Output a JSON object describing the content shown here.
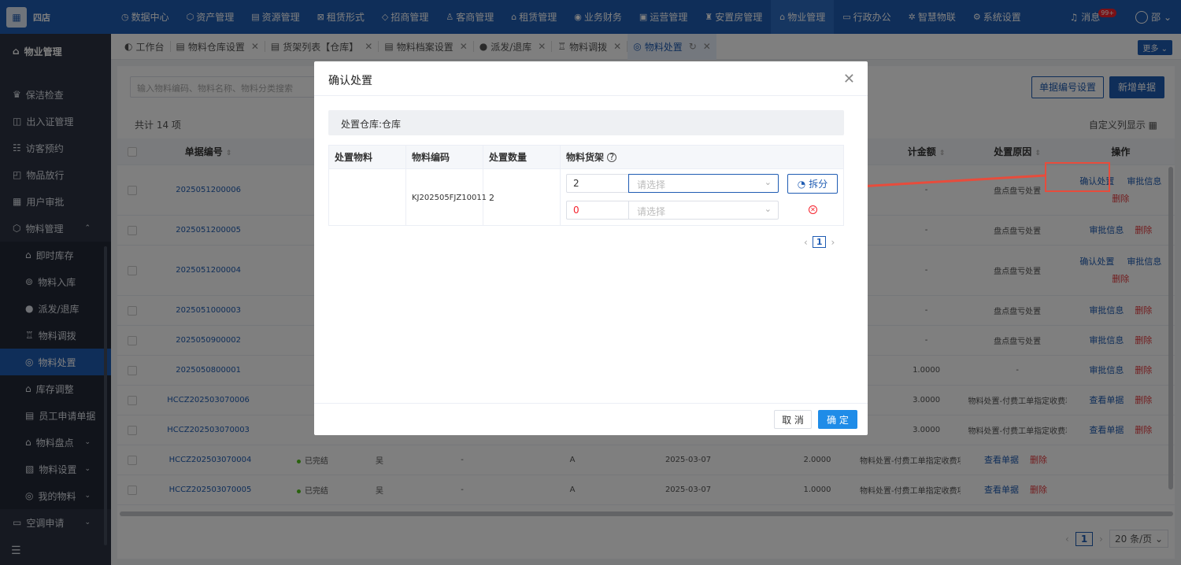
{
  "app": {
    "logo_text": "四店"
  },
  "topnav": {
    "items": [
      {
        "label": "数据中心",
        "icon": "◷"
      },
      {
        "label": "资产管理",
        "icon": "⬡"
      },
      {
        "label": "资源管理",
        "icon": "▤"
      },
      {
        "label": "租赁形式",
        "icon": "⊠"
      },
      {
        "label": "招商管理",
        "icon": "◇"
      },
      {
        "label": "客商管理",
        "icon": "♙"
      },
      {
        "label": "租赁管理",
        "icon": "⌂"
      },
      {
        "label": "业务财务",
        "icon": "◉"
      },
      {
        "label": "运营管理",
        "icon": "▣"
      },
      {
        "label": "安置房管理",
        "icon": "♜"
      },
      {
        "label": "物业管理",
        "icon": "⌂"
      },
      {
        "label": "行政办公",
        "icon": "▭"
      },
      {
        "label": "智慧物联",
        "icon": "✲"
      },
      {
        "label": "系统设置",
        "icon": "⚙"
      }
    ],
    "active_index": 10,
    "message_label": "消息",
    "badge": "99+",
    "user_name": "邵"
  },
  "sidebar": {
    "title": "物业管理",
    "items": [
      {
        "label": "保洁检查",
        "icon": "♛"
      },
      {
        "label": "出入证管理",
        "icon": "◫"
      },
      {
        "label": "访客预约",
        "icon": "☷"
      },
      {
        "label": "物品放行",
        "icon": "◰"
      },
      {
        "label": "用户审批",
        "icon": "▦"
      },
      {
        "label": "物料管理",
        "icon": "⬡",
        "arrow": "⌃"
      }
    ],
    "sub_items": [
      {
        "label": "即时库存",
        "icon": "⌂"
      },
      {
        "label": "物料入库",
        "icon": "⊚"
      },
      {
        "label": "派发/退库",
        "icon": "●"
      },
      {
        "label": "物料调拨",
        "icon": "♖"
      },
      {
        "label": "物料处置",
        "icon": "◎"
      },
      {
        "label": "库存调整",
        "icon": "⌂"
      },
      {
        "label": "员工申请单据",
        "icon": "▤"
      },
      {
        "label": "物料盘点",
        "icon": "⌂",
        "arrow": "⌄"
      },
      {
        "label": "物料设置",
        "icon": "▧",
        "arrow": "⌄"
      },
      {
        "label": "我的物料",
        "icon": "◎",
        "arrow": "⌄"
      }
    ],
    "after_items": [
      {
        "label": "空调申请",
        "icon": "▭",
        "arrow": "⌄"
      }
    ]
  },
  "tabs": [
    {
      "label": "工作台",
      "icon": "◐",
      "closable": false
    },
    {
      "label": "物料仓库设置",
      "icon": "▤",
      "closable": true
    },
    {
      "label": "货架列表【仓库】",
      "icon": "▤",
      "closable": true
    },
    {
      "label": "物料档案设置",
      "icon": "▤",
      "closable": true
    },
    {
      "label": "派发/退库",
      "icon": "●",
      "closable": true
    },
    {
      "label": "物料调拨",
      "icon": "♖",
      "closable": true
    },
    {
      "label": "物料处置",
      "icon": "◎",
      "closable": true,
      "active": true
    }
  ],
  "more_label": "更多",
  "toolbar": {
    "search_placeholder": "输入物料编码、物料名称、物料分类搜索",
    "btn_code_setting": "单据编号设置",
    "btn_new": "新增单据"
  },
  "list": {
    "total": "共计 14 项",
    "col_setting": "自定义列显示",
    "headers": {
      "no": "单据编号",
      "amount": "计金额",
      "reason": "处置原因",
      "ops": "操作"
    },
    "rows": [
      {
        "no": "2025051200006",
        "amount": "-",
        "reason": "盘点盘亏处置",
        "ops": [
          "确认处置",
          "审批信息"
        ],
        "del": "删除",
        "two_line": true
      },
      {
        "no": "2025051200005",
        "amount": "-",
        "reason": "盘点盘亏处置",
        "ops": [
          "审批信息"
        ],
        "del": "删除"
      },
      {
        "no": "2025051200004",
        "amount": "-",
        "reason": "盘点盘亏处置",
        "ops": [
          "确认处置",
          "审批信息"
        ],
        "del": "删除",
        "two_line": true
      },
      {
        "no": "2025051000003",
        "amount": "-",
        "reason": "盘点盘亏处置",
        "ops": [
          "审批信息"
        ],
        "del": "删除"
      },
      {
        "no": "2025050900002",
        "amount": "-",
        "reason": "盘点盘亏处置",
        "ops": [
          "审批信息"
        ],
        "del": "删除"
      },
      {
        "no": "2025050800001",
        "amount": "1.0000",
        "reason": "-",
        "ops": [
          "审批信息"
        ],
        "del": "删除"
      },
      {
        "no": "HCCZ202503070006",
        "amount": "3.0000",
        "reason": "物料处置-付费工单指定收费项",
        "ops": [
          "查看单据"
        ],
        "del": "删除"
      },
      {
        "no": "HCCZ202503070003",
        "amount": "3.0000",
        "reason": "物料处置-付费工单指定收费项",
        "ops": [
          "查看单据"
        ],
        "del": "删除"
      },
      {
        "no": "HCCZ202503070004",
        "status": "已完结",
        "who": "吴",
        "dash": "-",
        "a": "A",
        "date": "2025-03-07",
        "amount": "2.0000",
        "reason": "物料处置-付费工单指定收费项",
        "ops": [
          "查看单据"
        ],
        "del": "删除"
      },
      {
        "no": "HCCZ202503070005",
        "status": "已完结",
        "who": "吴",
        "dash": "-",
        "a": "A",
        "date": "2025-03-07",
        "amount": "1.0000",
        "reason": "物料处置-付费工单指定收费项",
        "ops": [
          "查看单据"
        ],
        "del": "删除"
      }
    ],
    "page": "1",
    "page_size": "20 条/页"
  },
  "modal": {
    "title": "确认处置",
    "warehouse": "处置仓库:仓库",
    "headers": {
      "material": "处置物料",
      "code": "物料编码",
      "qty": "处置数量",
      "shelf": "物料货架"
    },
    "row": {
      "material": "",
      "code": "KJ202505FJZ10011",
      "qty": "2"
    },
    "split_rows": [
      {
        "qty": "2",
        "placeholder": "请选择"
      },
      {
        "qty": "0",
        "placeholder": "请选择"
      }
    ],
    "split_label": "拆分",
    "page": "1",
    "cancel": "取 消",
    "ok": "确 定"
  }
}
